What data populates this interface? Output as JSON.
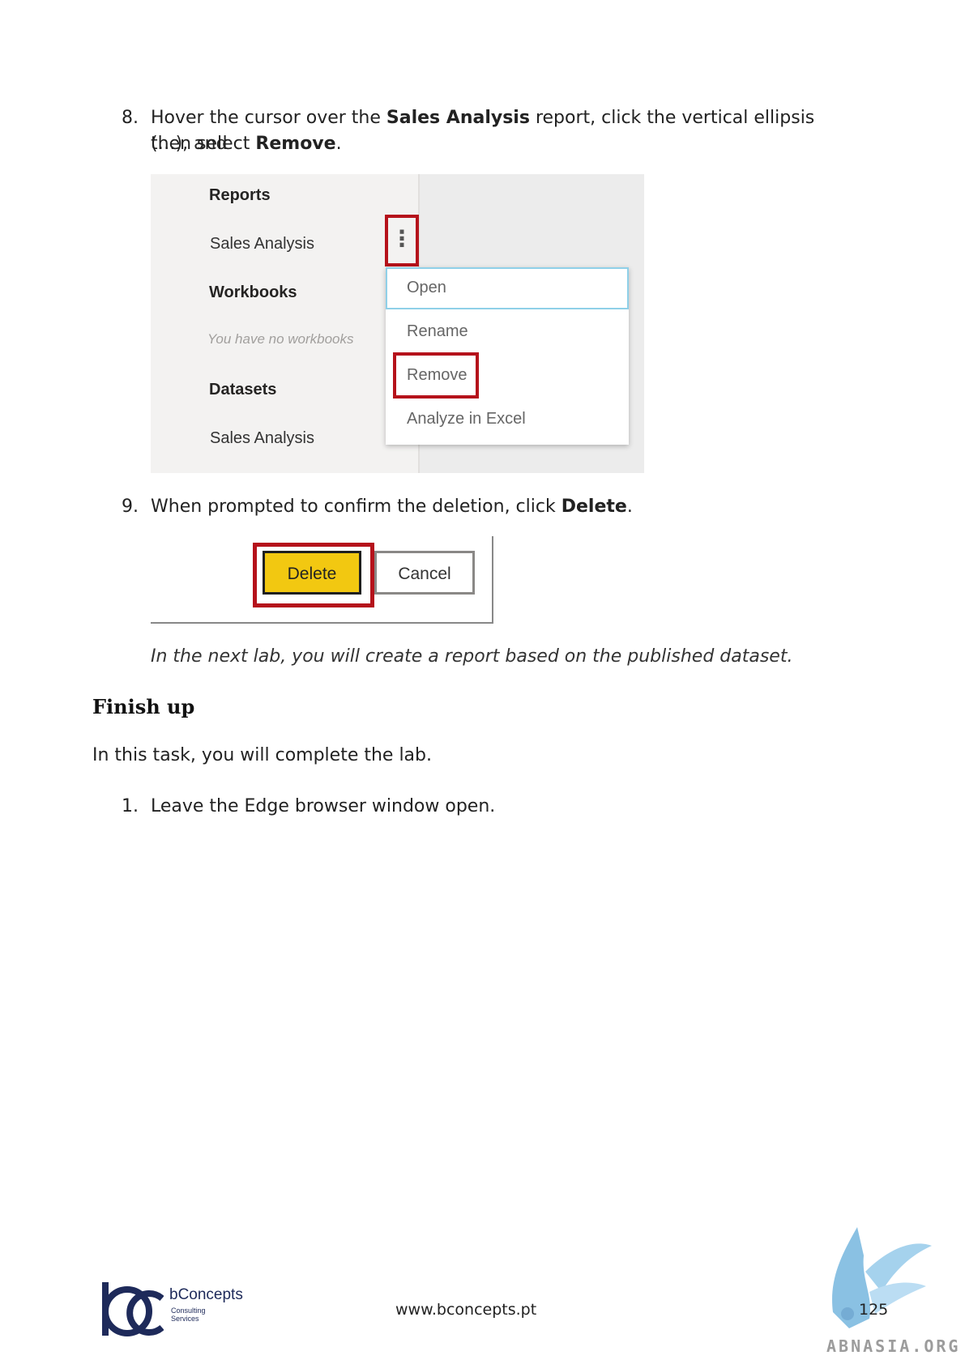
{
  "step8": {
    "number": "8.",
    "line1_a": "Hover the cursor over the ",
    "line1_b": "Sales Analysis",
    "line1_c": " report, click the vertical ellipsis (…), and",
    "line2_a": "then select ",
    "line2_b": "Remove",
    "line2_c": "."
  },
  "screenshot1": {
    "reports_heading": "Reports",
    "report_item": "Sales Analysis",
    "workbooks_heading": "Workbooks",
    "workbooks_empty": "You have no workbooks",
    "datasets_heading": "Datasets",
    "dataset_item": "Sales Analysis",
    "ellipsis": "⋮",
    "menu": [
      "Open",
      "Rename",
      "Remove",
      "Analyze in Excel"
    ]
  },
  "step9": {
    "number": "9.",
    "text_a": "When prompted to confirm the deletion, click ",
    "text_b": "Delete",
    "text_c": "."
  },
  "screenshot2": {
    "delete_label": "Delete",
    "cancel_label": "Cancel"
  },
  "note": "In the next lab, you will create a report based on the published dataset.",
  "finish": {
    "heading": "Finish up",
    "intro": "In this task, you will complete the lab.",
    "step_number": "1.",
    "step_text": "Leave the Edge browser window open."
  },
  "footer": {
    "logo_name": "bConcepts",
    "logo_sub1": "Consulting",
    "logo_sub2": "Services",
    "url": "www.bconcepts.pt",
    "page_number": "125",
    "watermark": "ABNASIA.ORG"
  },
  "colors": {
    "highlight_red": "#b5121b",
    "delete_yellow": "#f2c811",
    "brand_navy": "#1e2a5a"
  }
}
